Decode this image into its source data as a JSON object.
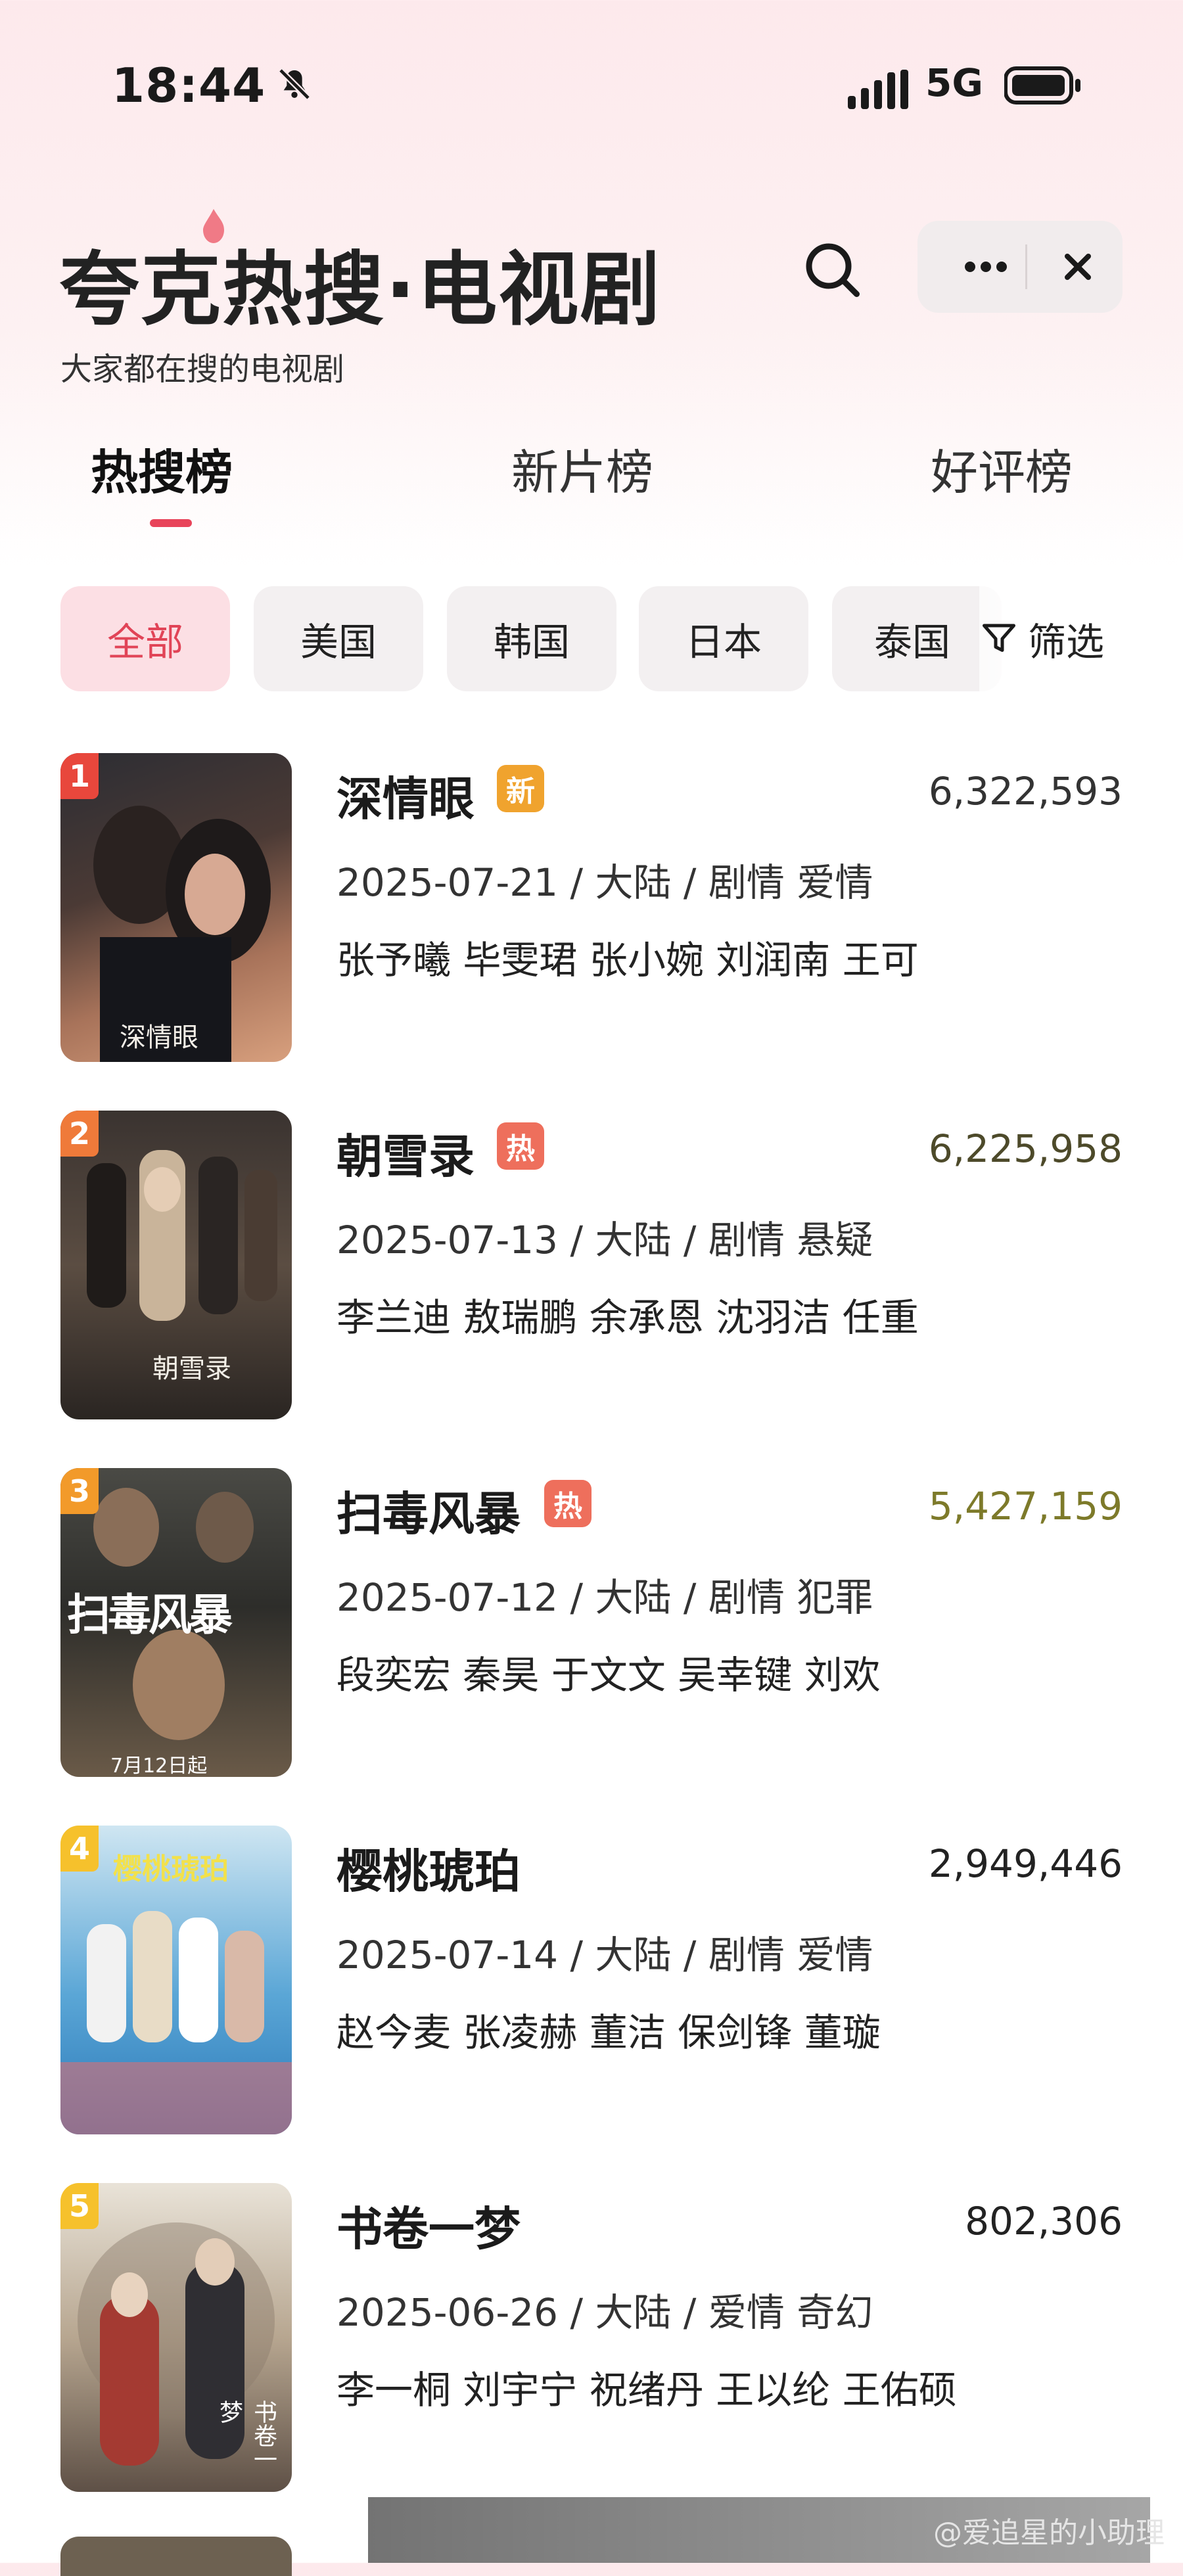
{
  "status_bar": {
    "time": "18:44",
    "network": "5G",
    "icons": [
      "bell-muted-icon",
      "signal-icon",
      "battery-icon"
    ]
  },
  "header": {
    "title": "夸克热搜·电视剧",
    "subtitle": "大家都在搜的电视剧",
    "icons": [
      "search-icon",
      "more-icon",
      "close-icon"
    ]
  },
  "tabs": [
    {
      "label": "热搜榜",
      "active": true
    },
    {
      "label": "新片榜",
      "active": false
    },
    {
      "label": "好评榜",
      "active": false
    }
  ],
  "filters": {
    "chips": [
      {
        "label": "全部",
        "active": true
      },
      {
        "label": "美国",
        "active": false
      },
      {
        "label": "韩国",
        "active": false
      },
      {
        "label": "日本",
        "active": false
      },
      {
        "label": "泰国",
        "active": false
      }
    ],
    "filter_label": "筛选"
  },
  "colors": {
    "accent": "#e8445a",
    "rank1": "#e8473c",
    "rank2": "#ef7a3a",
    "rank3": "#f29a2a",
    "rank4": "#f6c12c",
    "rank5": "#f6c12c",
    "badge_new": "#f0a32e",
    "badge_hot": "#ee6f5c"
  },
  "list": [
    {
      "rank": "1",
      "name": "深情眼",
      "badge": "新",
      "heat": "6,322,593",
      "meta": "2025-07-21 / 大陆 / 剧情 爱情",
      "cast": "张予曦 毕雯珺 张小婉 刘润南 王可",
      "poster_text": "深情眼"
    },
    {
      "rank": "2",
      "name": "朝雪录",
      "badge": "热",
      "heat": "6,225,958",
      "meta": "2025-07-13 / 大陆 / 剧情 悬疑",
      "cast": "李兰迪 敖瑞鹏 余承恩 沈羽洁 任重",
      "poster_text": "朝雪录"
    },
    {
      "rank": "3",
      "name": "扫毒风暴",
      "badge": "热",
      "heat": "5,427,159",
      "meta": "2025-07-12 / 大陆 / 剧情 犯罪",
      "cast": "段奕宏 秦昊 于文文 吴幸键 刘欢",
      "poster_text": "扫毒风暴",
      "poster_date": "7月12日起"
    },
    {
      "rank": "4",
      "name": "樱桃琥珀",
      "badge": "",
      "heat": "2,949,446",
      "meta": "2025-07-14 / 大陆 / 剧情 爱情",
      "cast": "赵今麦 张凌赫 董洁 保剑锋 董璇",
      "poster_text": "樱桃琥珀"
    },
    {
      "rank": "5",
      "name": "书卷一梦",
      "badge": "",
      "heat": "802,306",
      "meta": "2025-06-26 / 大陆 / 爱情 奇幻",
      "cast": "李一桐 刘宇宁 祝绪丹 王以纶 王佑硕",
      "poster_text": "书卷一梦"
    }
  ],
  "watermark": "@爱追星的小助理"
}
